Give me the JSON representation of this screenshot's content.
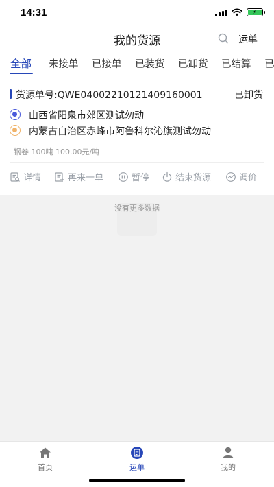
{
  "status_bar": {
    "time": "14:31",
    "battery_icon": "battery-charging-icon"
  },
  "nav": {
    "title": "我的货源",
    "search_icon": "search-icon",
    "waybill_label": "运单"
  },
  "tabs": [
    {
      "label": "全部",
      "active": true
    },
    {
      "label": "未接单"
    },
    {
      "label": "已接单"
    },
    {
      "label": "已装货"
    },
    {
      "label": "已卸货"
    },
    {
      "label": "已结算"
    },
    {
      "label": "已"
    }
  ],
  "order": {
    "number": "货源单号:QWE0400221012140916000​1",
    "status": "已卸货",
    "origin": "山西省阳泉市郊区测试勿动",
    "destination": "内蒙古自治区赤峰市阿鲁科尔沁旗测试勿动",
    "goods": "钢卷 100吨 100.00元/吨",
    "actions": [
      {
        "label": "详情",
        "icon": "detail-icon"
      },
      {
        "label": "再来一单",
        "icon": "reorder-icon"
      },
      {
        "label": "暂停",
        "icon": "pause-icon"
      },
      {
        "label": "结束货源",
        "icon": "power-icon"
      },
      {
        "label": "调价",
        "icon": "price-adjust-icon"
      }
    ]
  },
  "list_footer": "没有更多数据",
  "tabbar": [
    {
      "label": "首页",
      "icon": "home-icon"
    },
    {
      "label": "运单",
      "icon": "waybill-icon",
      "active": true
    },
    {
      "label": "我的",
      "icon": "profile-icon"
    }
  ],
  "colors": {
    "accent": "#2747b8",
    "origin_dot": "#4b5bdb",
    "dest_dot": "#f0b36a",
    "battery": "#34c759"
  }
}
